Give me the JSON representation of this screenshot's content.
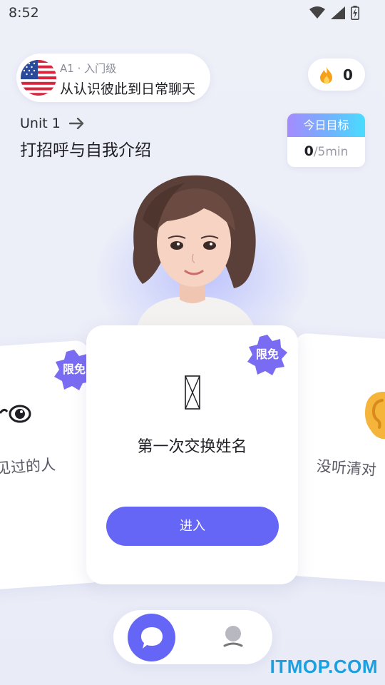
{
  "status_bar": {
    "time": "8:52"
  },
  "course": {
    "level": "A1 · 入门级",
    "name": "从认识彼此到日常聊天",
    "flag_icon": "us-flag-icon"
  },
  "streak": {
    "count": "0",
    "icon": "fire-icon"
  },
  "unit": {
    "label": "Unit 1",
    "title": "打招呼与自我介绍"
  },
  "daily_goal": {
    "header": "今日目标",
    "done": "0",
    "total": "/5min"
  },
  "cards": {
    "badge": "限免",
    "left_text": "见过的人",
    "center_title": "第一次交换姓名",
    "center_button": "进入",
    "right_text": "没听清对"
  },
  "nav": {
    "chat_icon": "chat-bubble-icon",
    "profile_icon": "profile-icon"
  },
  "watermark": "ITMOP.COM",
  "colors": {
    "accent": "#6566f5",
    "badge": "#7a6cf2",
    "watermark": "#1a9fe0"
  }
}
